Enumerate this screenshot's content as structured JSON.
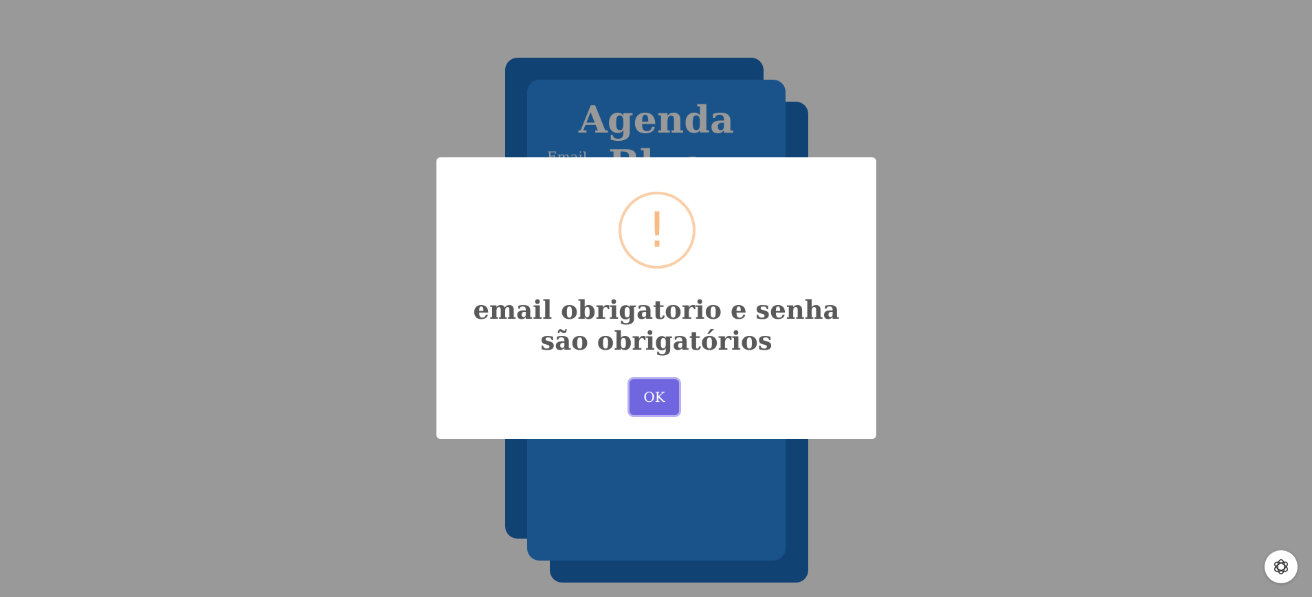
{
  "background": {
    "app_title": "Agenda Blue",
    "email_label": "Email"
  },
  "alert": {
    "icon": "warning-exclamation-icon",
    "icon_glyph": "!",
    "message": "email obrigatorio e senha são obrigatórios",
    "ok_label": "OK"
  },
  "floating": {
    "icon": "openai-logo-icon"
  },
  "colors": {
    "overlay": "rgba(0,0,0,0.4)",
    "card_primary": "#2a8ae6",
    "card_secondary": "#1b6ec2",
    "warning": "#f8bb86",
    "confirm_button": "#7066e0",
    "title_text": "#595959"
  }
}
